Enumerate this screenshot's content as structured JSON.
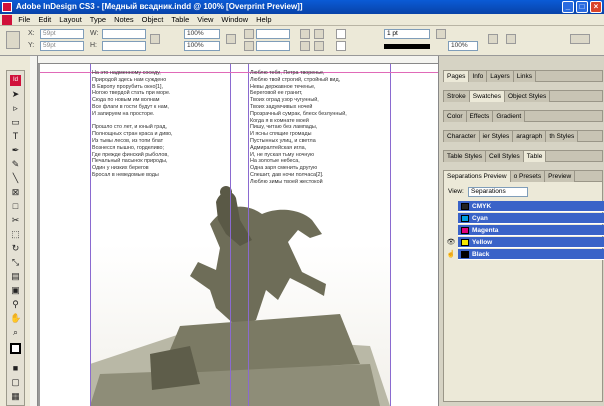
{
  "window": {
    "title": "Adobe InDesign CS3 - [Медный всадник.indd @ 100% [Overprint Preview]]"
  },
  "menu": [
    "File",
    "Edit",
    "Layout",
    "Type",
    "Notes",
    "Object",
    "Table",
    "View",
    "Window",
    "Help"
  ],
  "control": {
    "x_label": "X:",
    "x_value": "59pt",
    "y_label": "Y:",
    "y_value": "59pt",
    "w_label": "W:",
    "h_label": "H:",
    "zoom1": "100%",
    "zoom2": "100%",
    "stroke_weight": "1 pt"
  },
  "document": {
    "left_column": [
      "На это надменному соседу,",
      "Природой здесь нам суждено",
      "В Европу прорубить окно[1],",
      "Ногою твердой стать при море.",
      "Сюда по новым им волнам",
      "Все флаги в гости будут к нам,",
      "И запируем на просторе.",
      "",
      "Прошло сто лет, и юный град,",
      "Полнощных стран краса и диво,",
      "Из тьмы лесов, из топи блат",
      "Вознесся пышно, горделиво;",
      "Где прежде финский рыболов,",
      "Печальный пасынок природы,",
      "Один у низких берегов",
      "Бросал в неведомые воды"
    ],
    "right_column": [
      "Люблю тебя, Петра творенье,",
      "Люблю твой строгий, стройный вид,",
      "Невы державное теченье,",
      "Береговой ее гранит,",
      "Твоих оград узор чугунный,",
      "Твоих задумчивых ночей",
      "Прозрачный сумрак, блеск безлунный,",
      "Когда я в комнате моей",
      "Пишу, читаю без лампады,",
      "И ясны спящие громады",
      "Пустынных улиц, и светла",
      "Адмиралтейская игла,",
      "И, не пуская тьму ночную",
      "На золотые небеса,",
      "Одна заря сменить другую",
      "Спешит, дав ночи полчаса[2].",
      "Люблю зимы твоей жестокой"
    ]
  },
  "panels": {
    "row1": [
      "Pages",
      "Info",
      "Layers",
      "Links"
    ],
    "row2": [
      "Stroke",
      "Swatches",
      "Object Styles"
    ],
    "row3": [
      "Color",
      "Effects",
      "Gradient"
    ],
    "row4": [
      "Character",
      "ier Styles",
      "aragraph",
      "th Styles"
    ],
    "row5": [
      "Table Styles",
      "Cell Styles",
      "Table"
    ],
    "row6": [
      "Separations Preview",
      "o Presets",
      "Preview"
    ],
    "view_label": "View:",
    "view_value": "Separations",
    "separations": [
      {
        "name": "CMYK",
        "color": "#222222"
      },
      {
        "name": "Cyan",
        "color": "#00a0e0"
      },
      {
        "name": "Magenta",
        "color": "#e0007a"
      },
      {
        "name": "Yellow",
        "color": "#f5e600"
      },
      {
        "name": "Black",
        "color": "#000000"
      }
    ]
  }
}
